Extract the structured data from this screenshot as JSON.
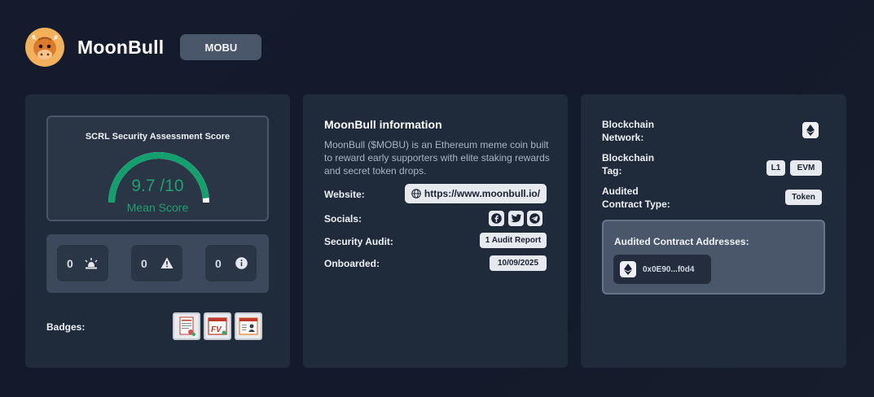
{
  "header": {
    "project_name": "MoonBull",
    "ticker": "MOBU"
  },
  "score_card": {
    "label": "SCRL Security Assessment Score",
    "score": "9.7 /10",
    "score_fraction": 0.97,
    "mean_label": "Mean Score",
    "counts": [
      {
        "value": "0",
        "icon": "alarm-icon"
      },
      {
        "value": "0",
        "icon": "warning-icon"
      },
      {
        "value": "0",
        "icon": "info-icon"
      }
    ],
    "badges_label": "Badges:",
    "badges": [
      "audit-certificate-icon",
      "formal-verification-icon",
      "kyc-icon"
    ],
    "colors": {
      "gauge": "#13a06e",
      "score_text": "#1fa070"
    }
  },
  "info_card": {
    "title": "MoonBull information",
    "description": "MoonBull ($MOBU) is an Ethereum meme coin built to reward early supporters with elite staking rewards and secret token drops.",
    "website_label": "Website:",
    "website_value": "https://www.moonbull.io/",
    "socials_label": "Socials:",
    "socials": [
      "facebook-icon",
      "twitter-icon",
      "telegram-icon"
    ],
    "audit_label": "Security Audit:",
    "audit_value": "1 Audit Report",
    "onboarded_label": "Onboarded:",
    "onboarded_value": "10/09/2025"
  },
  "chain_card": {
    "network_label_1": "Blockchain",
    "network_label_2": "Network:",
    "network_icon": "ethereum-icon",
    "tag_label_1": "Blockchain",
    "tag_label_2": "Tag:",
    "tags": [
      "L1",
      "EVM"
    ],
    "contract_type_label_1": "Audited",
    "contract_type_label_2": "Contract Type:",
    "contract_type_value": "Token",
    "addresses_label": "Audited Contract Addresses:",
    "addresses": [
      "0x0E90...f0d4"
    ]
  }
}
